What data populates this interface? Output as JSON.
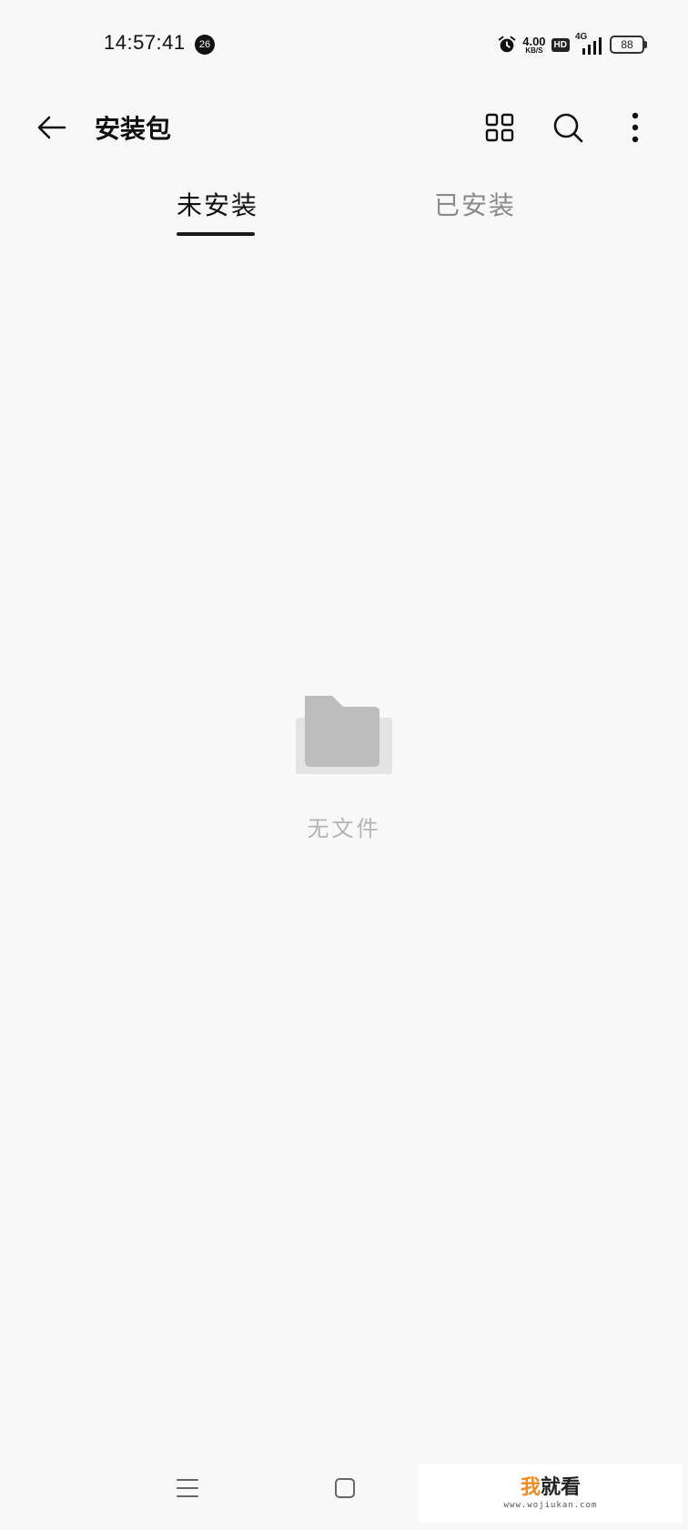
{
  "status_bar": {
    "time": "14:57:41",
    "notification_count": "26",
    "net_speed_value": "4.00",
    "net_speed_unit": "KB/S",
    "hd_label": "HD",
    "network_type": "4G",
    "battery_level": "88",
    "icons": [
      "alarm-icon",
      "signal-icon",
      "battery-icon"
    ]
  },
  "app_bar": {
    "title": "安装包",
    "icons": [
      "back-arrow-icon",
      "grid-view-icon",
      "search-icon",
      "more-vert-icon"
    ]
  },
  "tabs": [
    {
      "label": "未安装",
      "selected": true
    },
    {
      "label": "已安装",
      "selected": false
    }
  ],
  "empty_state": {
    "message": "无文件",
    "icon": "folder-icon"
  },
  "nav_bar": {
    "icons": [
      "menu-icon",
      "home-icon"
    ]
  },
  "watermark": {
    "logo_accent": "我",
    "logo_rest": "就看",
    "url": "www.wojiukan.com"
  },
  "colors": {
    "background": "#f8f8f8",
    "text_primary": "#111111",
    "text_secondary": "#8a8a8a",
    "empty_text": "#b4b4b4",
    "folder": "#bdbdbd",
    "watermark_accent": "#f08a24"
  }
}
